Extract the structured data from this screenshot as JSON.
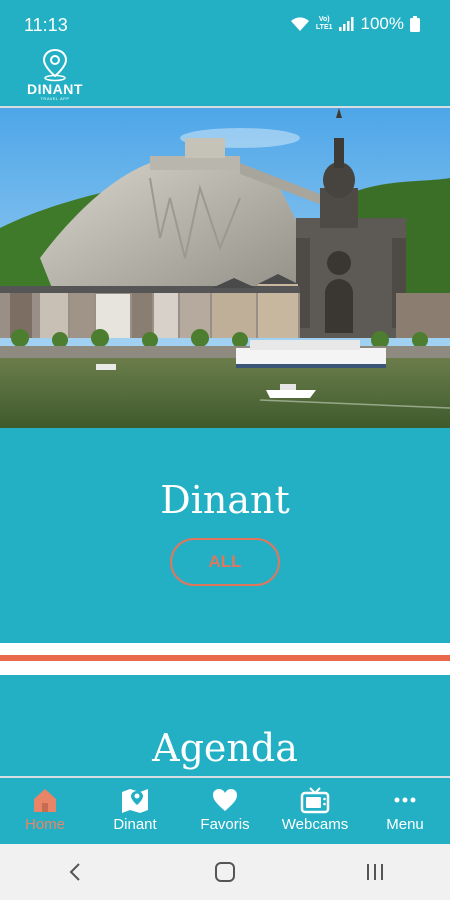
{
  "status_bar": {
    "time": "11:13",
    "battery": "100%",
    "network_label_top": "Vo)",
    "network_label_bottom": "LTE1"
  },
  "header": {
    "logo_text": "DINANT",
    "logo_subtext": "TRAVEL APP"
  },
  "hero": {
    "alt": "Dinant citadel and collegiate church over the Meuse river"
  },
  "sections": [
    {
      "title": "Dinant",
      "button_label": "ALL"
    },
    {
      "title": "Agenda"
    }
  ],
  "bottom_nav": {
    "items": [
      {
        "label": "Home",
        "icon": "home-icon",
        "active": true
      },
      {
        "label": "Dinant",
        "icon": "map-icon",
        "active": false
      },
      {
        "label": "Favoris",
        "icon": "heart-icon",
        "active": false
      },
      {
        "label": "Webcams",
        "icon": "tv-icon",
        "active": false
      },
      {
        "label": "Menu",
        "icon": "more-icon",
        "active": false
      }
    ]
  },
  "colors": {
    "primary": "#23b0c4",
    "accent": "#e96a4a",
    "accent_text": "#e0775d"
  }
}
